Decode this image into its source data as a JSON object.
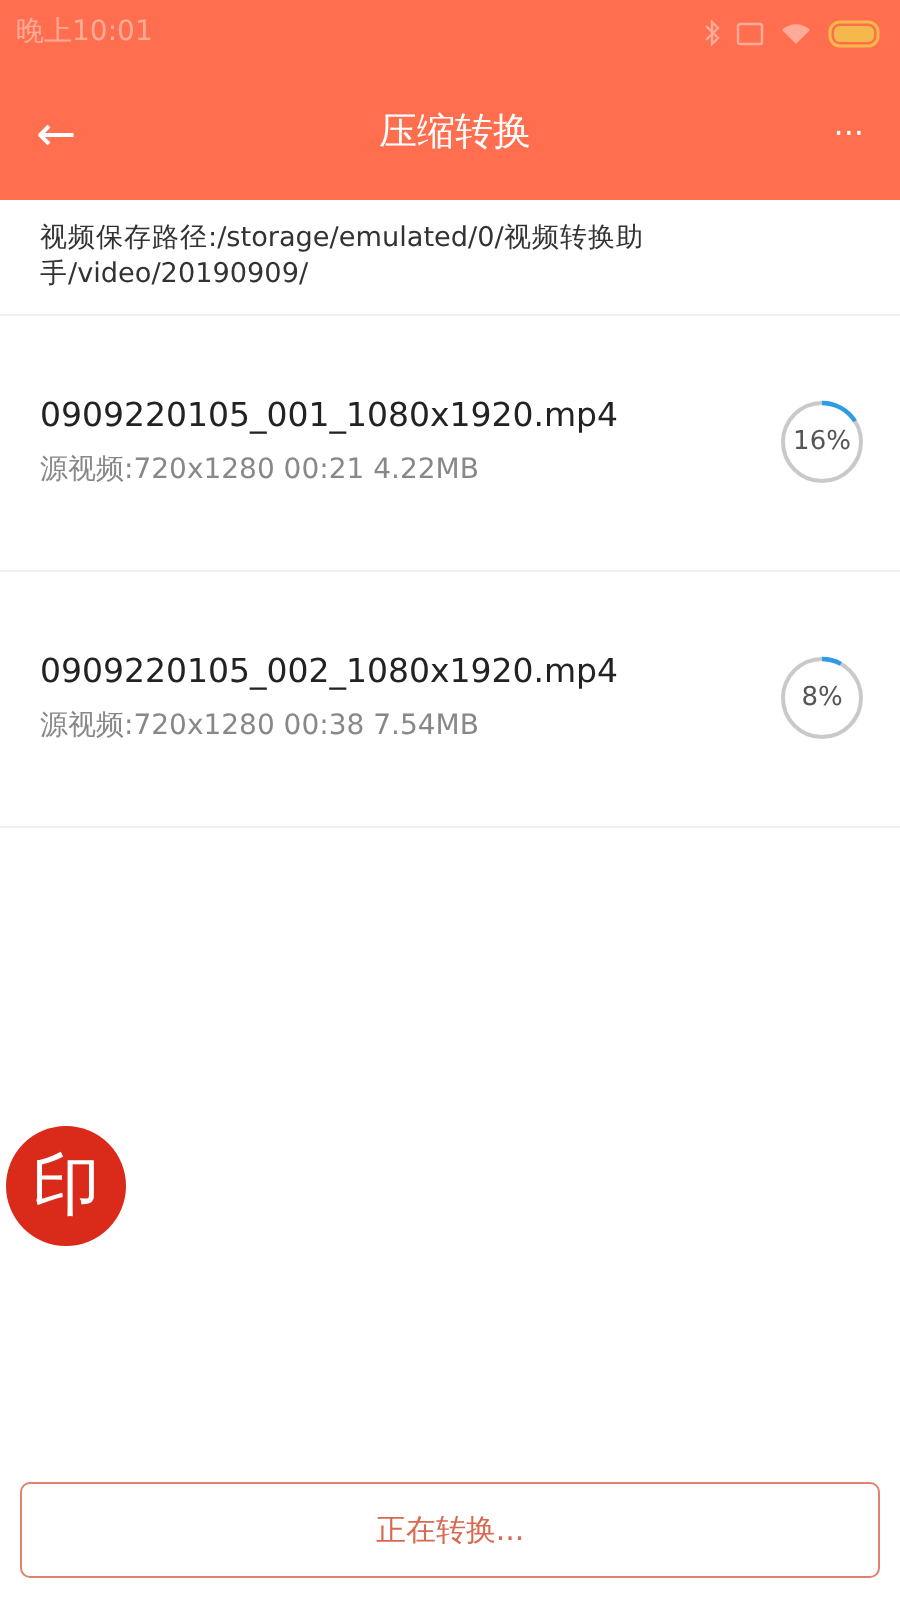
{
  "status_bar": {
    "time": "晚上10:01"
  },
  "app_bar": {
    "back": "←",
    "title": "压缩转换",
    "more": "···"
  },
  "save_path": "视频保存路径:/storage/emulated/0/视频转换助手/video/20190909/",
  "files": [
    {
      "name": "0909220105_001_1080x1920.mp4",
      "source": "源视频:720x1280 00:21 4.22MB",
      "level": 0.16,
      "reading": "16%"
    },
    {
      "name": "0909220105_002_1080x1920.mp4",
      "source": "源视频:720x1280 00:38 7.54MB",
      "level": 0.08,
      "reading": "8%"
    }
  ],
  "floating_button": {
    "label": "印"
  },
  "bottom_button": {
    "label": "正在转换...",
    "disabled": true
  }
}
